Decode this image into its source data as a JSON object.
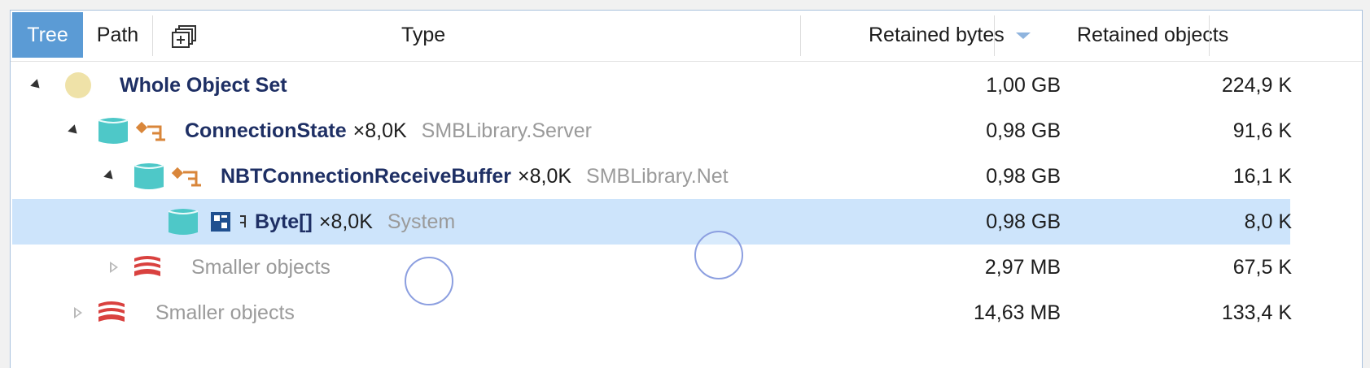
{
  "header": {
    "tab_tree": "Tree",
    "tab_path": "Path",
    "col_type": "Type",
    "col_retained_bytes": "Retained bytes",
    "col_retained_objects": "Retained objects",
    "sort_column": "Retained bytes",
    "sort_direction": "descending"
  },
  "colors": {
    "tab_active_bg": "#5b9bd5",
    "selected_row_bg": "#cde4fb",
    "bold_name": "#1e2f64",
    "namespace_gray": "#9a9a9a",
    "instance_icon": "#4ec8c8",
    "type_icon_orange": "#d9863a",
    "smaller_icon_red": "#d9413f",
    "whole_set_icon": "#efe2a8"
  },
  "rows": [
    {
      "name": "Whole Object Set",
      "count": "",
      "namespace": "",
      "retained_bytes": "1,00 GB",
      "retained_objects": "224,9 K",
      "icon": "whole-object-set-icon",
      "expanded": true
    },
    {
      "name": "ConnectionState",
      "count": "×8,0K",
      "namespace": "SMBLibrary.Server",
      "retained_bytes": "0,98 GB",
      "retained_objects": "91,6 K",
      "icon": "class-icon",
      "expanded": true
    },
    {
      "name": "NBTConnectionReceiveBuffer",
      "count": "×8,0K",
      "namespace": "SMBLibrary.Net",
      "retained_bytes": "0,98 GB",
      "retained_objects": "16,1 K",
      "icon": "class-icon",
      "expanded": true
    },
    {
      "name": "Byte[]",
      "count": "×8,0K",
      "namespace": "System",
      "retained_bytes": "0,98 GB",
      "retained_objects": "8,0 K",
      "icon": "array-icon",
      "selected": true
    },
    {
      "name": "Smaller objects",
      "retained_bytes": "2,97 MB",
      "retained_objects": "67,5 K",
      "icon": "smaller-objects-icon",
      "expanded": false
    },
    {
      "name": "Smaller objects",
      "retained_bytes": "14,63 MB",
      "retained_objects": "133,4 K",
      "icon": "smaller-objects-icon",
      "expanded": false
    }
  ]
}
